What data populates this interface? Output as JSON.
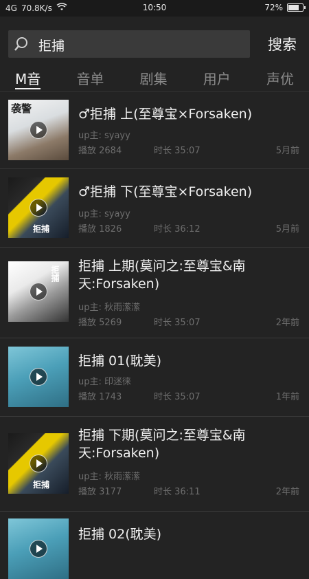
{
  "status_bar": {
    "signal": "4G",
    "speed": "70.8K/s",
    "time": "10:50",
    "battery_percent": "72%",
    "battery_level": 0.72
  },
  "search": {
    "value": "拒捕",
    "button_label": "搜索"
  },
  "tabs": [
    {
      "label": "M音",
      "active": true
    },
    {
      "label": "音单",
      "active": false
    },
    {
      "label": "剧集",
      "active": false
    },
    {
      "label": "用户",
      "active": false
    },
    {
      "label": "声优",
      "active": false
    }
  ],
  "results": [
    {
      "title": "♂拒捕 上(至尊宝×Forsaken)",
      "uploader": "up主: syayy",
      "plays": "播放 2684",
      "duration": "时长 35:07",
      "ago": "5月前",
      "cover_text": "袭警"
    },
    {
      "title": "♂拒捕 下(至尊宝×Forsaken)",
      "uploader": "up主: syayy",
      "plays": "播放 1826",
      "duration": "时长 36:12",
      "ago": "5月前",
      "cover_text": "拒捕"
    },
    {
      "title": "拒捕 上期(莫问之:至尊宝&南天:Forsaken)",
      "uploader": "up主: 秋雨潆潆",
      "plays": "播放 5269",
      "duration": "时长 35:07",
      "ago": "2年前",
      "cover_text": "拒捕"
    },
    {
      "title": "拒捕 01(耽美)",
      "uploader": "up主: 印迷徕",
      "plays": "播放 1743",
      "duration": "时长 35:07",
      "ago": "1年前",
      "cover_text": ""
    },
    {
      "title": "拒捕 下期(莫问之:至尊宝&南天:Forsaken)",
      "uploader": "up主: 秋雨潆潆",
      "plays": "播放 3177",
      "duration": "时长 36:11",
      "ago": "2年前",
      "cover_text": "拒捕"
    },
    {
      "title": "拒捕 02(耽美)",
      "uploader": "up主: 印迷徕",
      "plays": "",
      "duration": "",
      "ago": "",
      "cover_text": ""
    }
  ]
}
